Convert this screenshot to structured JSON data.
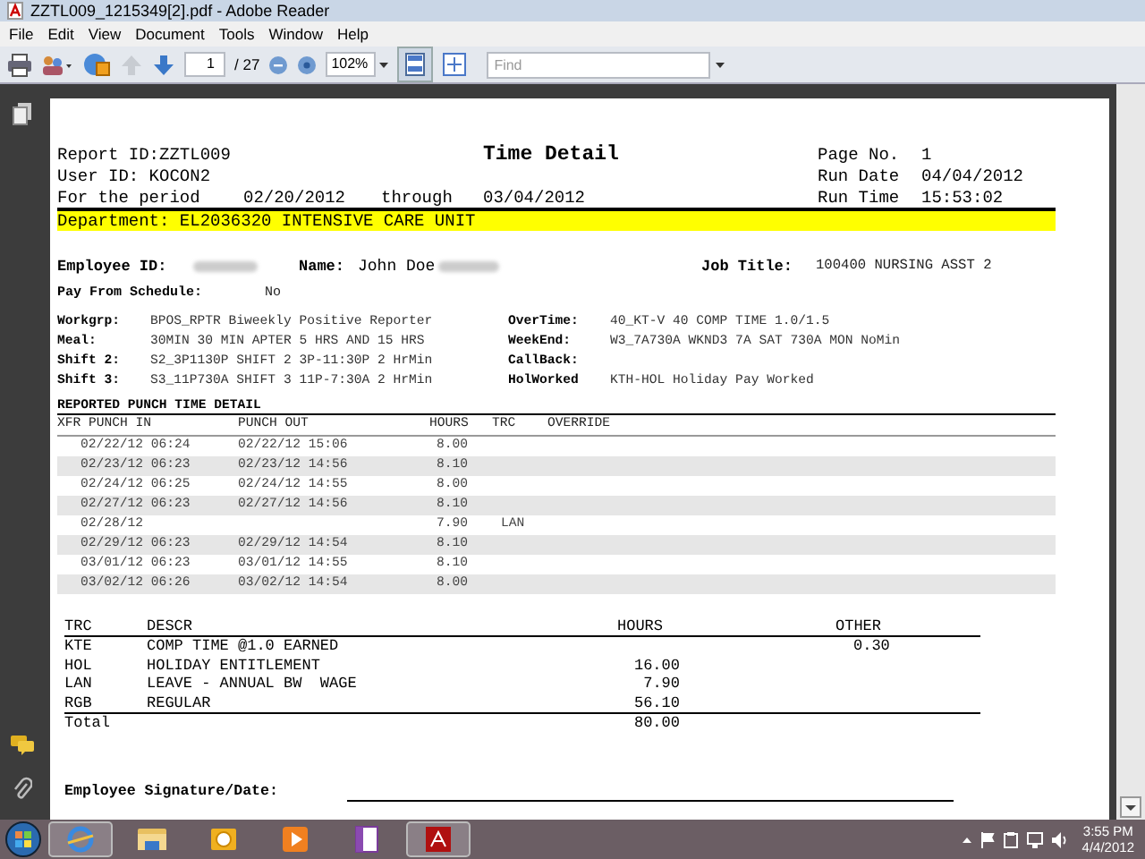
{
  "window": {
    "title": "ZZTL009_1215349[2].pdf - Adobe Reader"
  },
  "menu": [
    "File",
    "Edit",
    "View",
    "Document",
    "Tools",
    "Window",
    "Help"
  ],
  "toolbar": {
    "page": "1",
    "page_count": "/ 27",
    "zoom": "102%",
    "find_placeholder": "Find"
  },
  "report": {
    "report_id": "Report ID:ZZTL009",
    "user_id": "User ID: KOCON2",
    "title": "Time Detail",
    "period": {
      "label": "For the period",
      "from": "02/20/2012",
      "through": "through",
      "to": "03/04/2012"
    },
    "header_right": [
      {
        "label": "Page No.",
        "value": "1"
      },
      {
        "label": "Run Date",
        "value": "04/04/2012"
      },
      {
        "label": "Run Time",
        "value": "15:53:02"
      }
    ],
    "department": "Department: EL2036320 INTENSIVE CARE UNIT",
    "employee_id_label": "Employee ID:",
    "name_label": "Name:",
    "name": "John Doe",
    "job_title_label": "Job Title:",
    "job_title": "100400 NURSING ASST 2",
    "pay_from_schedule": {
      "label": "Pay From Schedule:",
      "value": "No"
    },
    "fields": [
      {
        "label": "Workgrp:",
        "value": "BPOS_RPTR Biweekly Positive Reporter",
        "right_label": "OverTime:",
        "right_value": "40_KT-V 40 COMP TIME 1.0/1.5"
      },
      {
        "label": "Meal:",
        "value": "30MIN 30 MIN APTER 5 HRS AND 15 HRS",
        "right_label": "WeekEnd:",
        "right_value": "W3_7A730A WKND3 7A SAT 730A MON NoMin"
      },
      {
        "label": "Shift 2:",
        "value": "S2_3P1130P SHIFT 2 3P-11:30P 2 HrMin",
        "right_label": "CallBack:"
      },
      {
        "label": "Shift 3:",
        "value": "S3_11P730A SHIFT 3 11P-7:30A 2 HrMin",
        "right_label": "HolWorked",
        "right_value": "KTH-HOL Holiday Pay Worked"
      }
    ],
    "punch": {
      "title": "REPORTED PUNCH TIME DETAIL",
      "columns": [
        "XFR PUNCH IN",
        "PUNCH OUT",
        "HOURS",
        "TRC",
        "OVERRIDE"
      ],
      "rows": [
        [
          "02/22/12 06:24",
          "02/22/12 15:06",
          "8.00",
          ""
        ],
        [
          "02/23/12 06:23",
          "02/23/12 14:56",
          "8.10",
          ""
        ],
        [
          "02/24/12 06:25",
          "02/24/12 14:55",
          "8.00",
          ""
        ],
        [
          "02/27/12 06:23",
          "02/27/12 14:56",
          "8.10",
          ""
        ],
        [
          "02/28/12",
          "",
          "7.90",
          "LAN"
        ],
        [
          "02/29/12 06:23",
          "02/29/12 14:54",
          "8.10",
          ""
        ],
        [
          "03/01/12 06:23",
          "03/01/12 14:55",
          "8.10",
          ""
        ],
        [
          "03/02/12 06:26",
          "03/02/12 14:54",
          "8.00",
          ""
        ]
      ]
    },
    "summary": {
      "columns": [
        "TRC",
        "DESCR",
        "HOURS",
        "OTHER"
      ],
      "rows": [
        [
          "KTE",
          "COMP TIME @1.0 EARNED",
          "",
          "0.30"
        ],
        [
          "HOL",
          "HOLIDAY ENTITLEMENT",
          "16.00",
          ""
        ],
        [
          "LAN",
          "LEAVE - ANNUAL BW  WAGE",
          "7.90",
          ""
        ],
        [
          "RGB",
          "REGULAR",
          "56.10",
          ""
        ]
      ],
      "total_label": "Total",
      "total_hours": "80.00"
    },
    "signature_label": "Employee Signature/Date:"
  },
  "taskbar": {
    "time": "3:55 PM",
    "date": "4/4/2012"
  }
}
